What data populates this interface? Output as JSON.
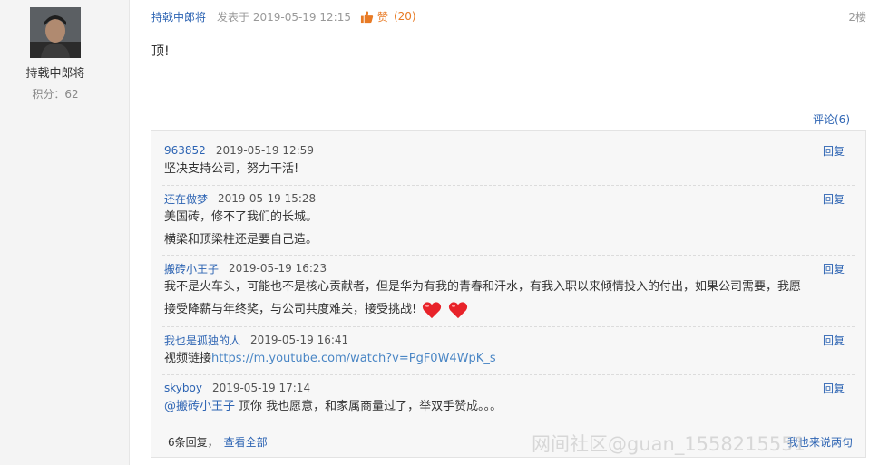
{
  "user": {
    "name": "持戟中郎将",
    "score_label": "积分：62"
  },
  "post": {
    "author": "持戟中郎将",
    "posted": "发表于 2019-05-19 12:15",
    "like_label": "赞",
    "like_count": "(20)",
    "floor": "2楼",
    "content": "顶!"
  },
  "comments_toggle": "评论(6)",
  "comments": [
    {
      "author": "963852",
      "time": "2019-05-19 12:59",
      "reply": "回复",
      "lines": [
        "坚决支持公司，努力干活!"
      ]
    },
    {
      "author": "还在做梦",
      "time": "2019-05-19 15:28",
      "reply": "回复",
      "lines": [
        "美国砖，修不了我们的长城。",
        "横梁和顶梁柱还是要自己造。"
      ]
    },
    {
      "author": "搬砖小王子",
      "time": "2019-05-19 16:23",
      "reply": "回复",
      "lines": [
        "我不是火车头，可能也不是核心贡献者，但是华为有我的青春和汗水，有我入职以来倾情投入的付出，如果公司需要，我愿",
        "接受降薪与年终奖，与公司共度难关，接受挑战!"
      ]
    },
    {
      "author": "我也是孤独的人",
      "time": "2019-05-19 16:41",
      "reply": "回复",
      "prefix": "视频链接",
      "url": "https://m.youtube.com/watch?v=PgF0W4WpK_s"
    },
    {
      "author": "skyboy",
      "time": "2019-05-19 17:14",
      "reply": "回复",
      "mention": "@搬砖小王子",
      "text": "顶你 我也愿意，和家属商量过了，举双手赞成。。。"
    }
  ],
  "footer": {
    "count_label": "6条回复，",
    "view_all": "查看全部",
    "say": "我也来说两句"
  },
  "watermark": "网间社区@guan_1558215551",
  "colors": {
    "link": "#2d64b3",
    "like": "#e87a24",
    "heart": "#e8232a",
    "panel": "#f4f4f4"
  },
  "icons": {
    "like": "thumbs-up-icon",
    "heart": "heart-icon"
  }
}
